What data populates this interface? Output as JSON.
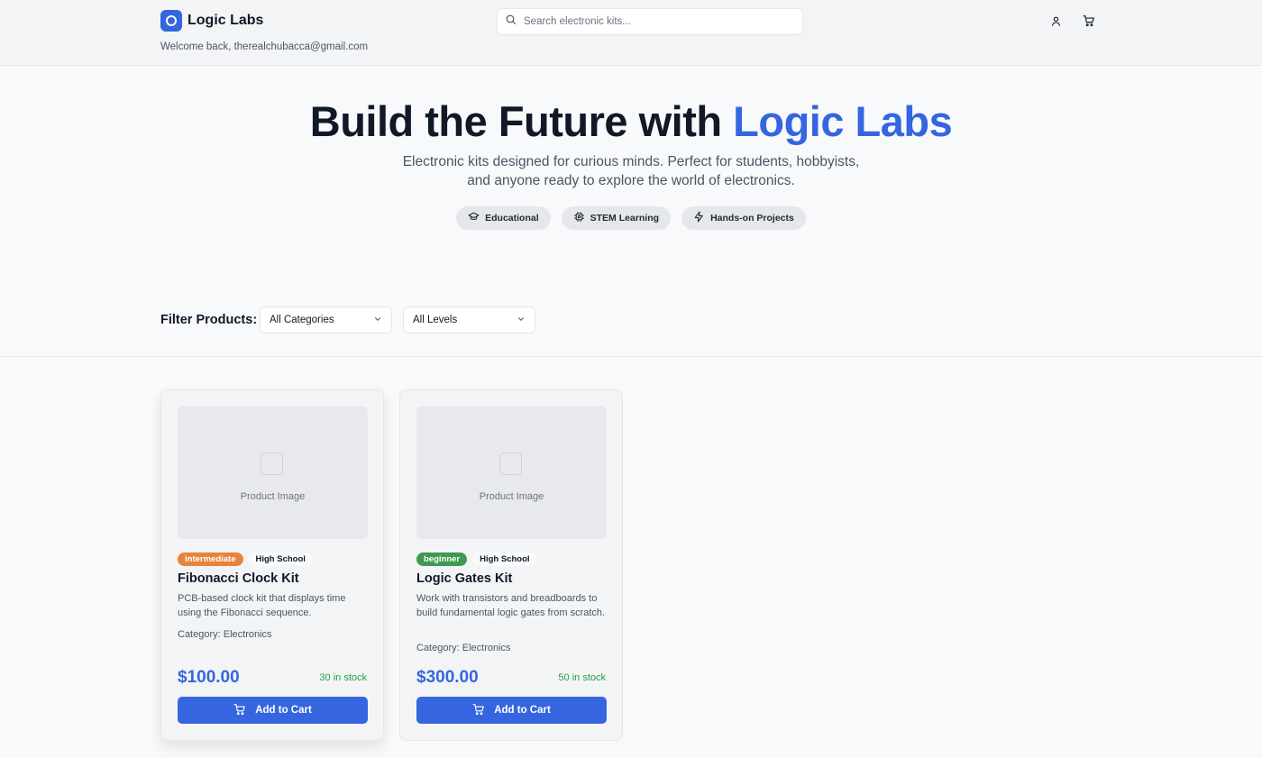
{
  "header": {
    "brand": "Logic Labs",
    "welcome": "Welcome back, therealchubacca@gmail.com",
    "search_placeholder": "Search electronic kits...",
    "icons": [
      "search-icon",
      "user-icon",
      "cart-icon"
    ]
  },
  "hero": {
    "title_prefix": "Build the Future with ",
    "title_accent": "Logic Labs",
    "subtitle_line1": "Electronic kits designed for curious minds. Perfect for students, hobbyists,",
    "subtitle_line2": "and anyone ready to explore the world of electronics.",
    "pills": [
      {
        "label": "Educational",
        "icon": "graduation-cap-icon"
      },
      {
        "label": "STEM Learning",
        "icon": "chip-icon"
      },
      {
        "label": "Hands-on Projects",
        "icon": "lightning-icon"
      }
    ]
  },
  "filters": {
    "label": "Filter Products:",
    "category": "All Categories",
    "level": "All Levels"
  },
  "products": [
    {
      "image_placeholder": "Product Image",
      "level": "intermediate",
      "level_color": "#e8833a",
      "audience": "High School",
      "name": "Fibonacci Clock Kit",
      "description": "PCB-based clock kit that displays time using the Fibonacci sequence.",
      "category": "Category: Electronics",
      "price": "$100.00",
      "stock": "30 in stock",
      "button": "Add to Cart"
    },
    {
      "image_placeholder": "Product Image",
      "level": "beginner",
      "level_color": "#3d9a4f",
      "audience": "High School",
      "name": "Logic Gates Kit",
      "description": "Work with transistors and breadboards to build fundamental logic gates from scratch.",
      "category": "Category: Electronics",
      "price": "$300.00",
      "stock": "50 in stock",
      "button": "Add to Cart"
    }
  ],
  "colors": {
    "accent": "#3566e0",
    "in_stock": "#22a046"
  }
}
